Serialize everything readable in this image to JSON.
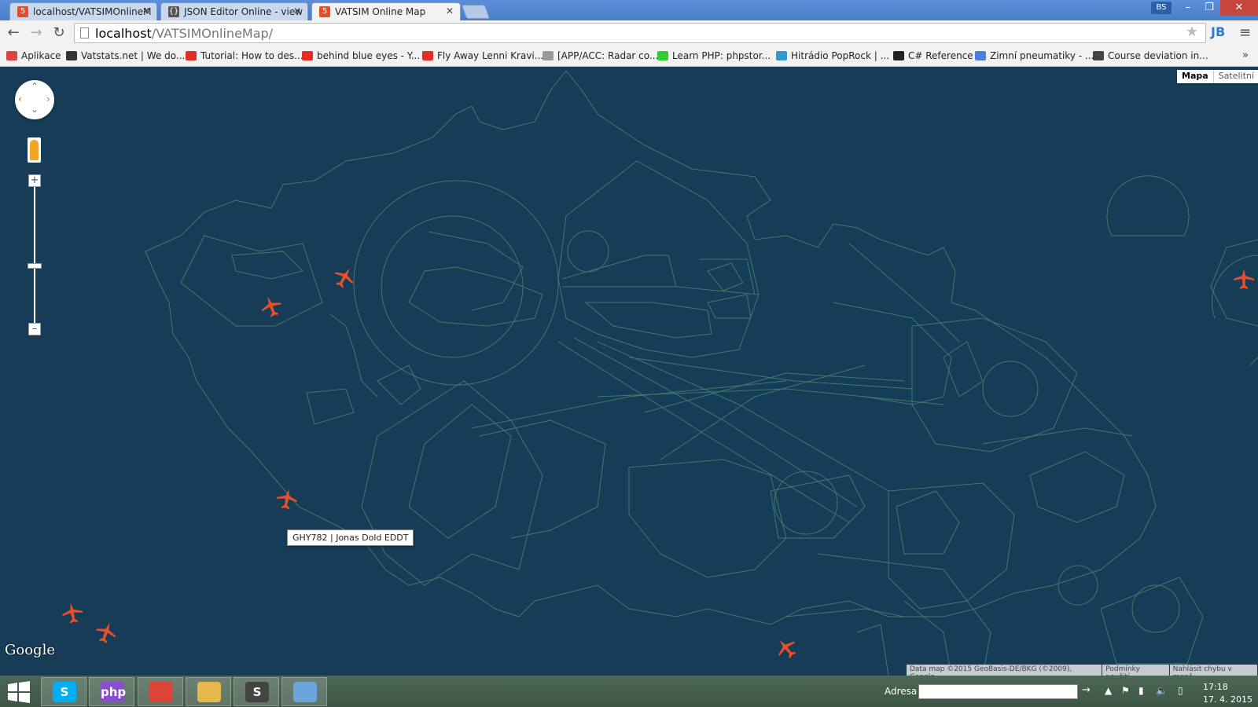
{
  "browser": {
    "tabs": [
      {
        "title": "localhost/VATSIMOnlineM",
        "icon": "html5-icon"
      },
      {
        "title": "JSON Editor Online - view",
        "icon": "braces-icon"
      },
      {
        "title": "VATSIM Online Map",
        "icon": "html5-icon",
        "active": true
      }
    ],
    "profile_badge": "BS",
    "url_host": "localhost",
    "url_path": "/VATSIMOnlineMap/",
    "bookmarks": [
      {
        "label": "Aplikace",
        "icon": "apps-grid-icon",
        "color": "#d44"
      },
      {
        "label": "Vatstats.net | We do...",
        "icon": "plane-icon",
        "color": "#333"
      },
      {
        "label": "Tutorial: How to des...",
        "icon": "youtube-icon",
        "color": "#e52d27"
      },
      {
        "label": "behind blue eyes - Y...",
        "icon": "youtube-icon",
        "color": "#e52d27"
      },
      {
        "label": "Fly Away Lenni Kravi...",
        "icon": "youtube-icon",
        "color": "#e52d27"
      },
      {
        "label": "[APP/ACC: Radar co...",
        "icon": "page-icon",
        "color": "#999"
      },
      {
        "label": "Learn PHP: phpstor...",
        "icon": "h-icon",
        "color": "#3c3"
      },
      {
        "label": "Hitrádio PopRock | ...",
        "icon": "radio-icon",
        "color": "#39c"
      },
      {
        "label": "C# Reference",
        "icon": "m-icon",
        "color": "#222"
      },
      {
        "label": "Zimní pneumatiky - ...",
        "icon": "g-icon",
        "color": "#4a7fe0"
      },
      {
        "label": "Course deviation in...",
        "icon": "wikipedia-icon",
        "color": "#444"
      }
    ],
    "bookmarks_more": "»"
  },
  "map": {
    "map_type_buttons": {
      "map": "Mapa",
      "satellite": "Satelitní"
    },
    "tooltip": "GHY782 | Jonas Dold EDDT",
    "logo": "Google",
    "attribution": {
      "data": "Data map ©2015 GeoBasis-DE/BKG (©2009), Google",
      "terms": "Podmínky použití",
      "report": "Nahlásit chybu v mapě"
    },
    "plane_color": "#e8502a",
    "sector_color": "#3f7a6a",
    "background": "#163c57"
  },
  "taskbar": {
    "apps": [
      {
        "name": "skype",
        "label": "S",
        "color": "#00aff0"
      },
      {
        "name": "phpstorm",
        "label": "php",
        "color": "#8a4fd0"
      },
      {
        "name": "chrome",
        "label": "",
        "color": "#db4437"
      },
      {
        "name": "explorer",
        "label": "",
        "color": "#e6b84c"
      },
      {
        "name": "sublime",
        "label": "S",
        "color": "#444"
      },
      {
        "name": "paint",
        "label": "",
        "color": "#6aa4d9"
      }
    ],
    "address_label": "Adresa",
    "time": "17:18",
    "date": "17. 4. 2015"
  }
}
